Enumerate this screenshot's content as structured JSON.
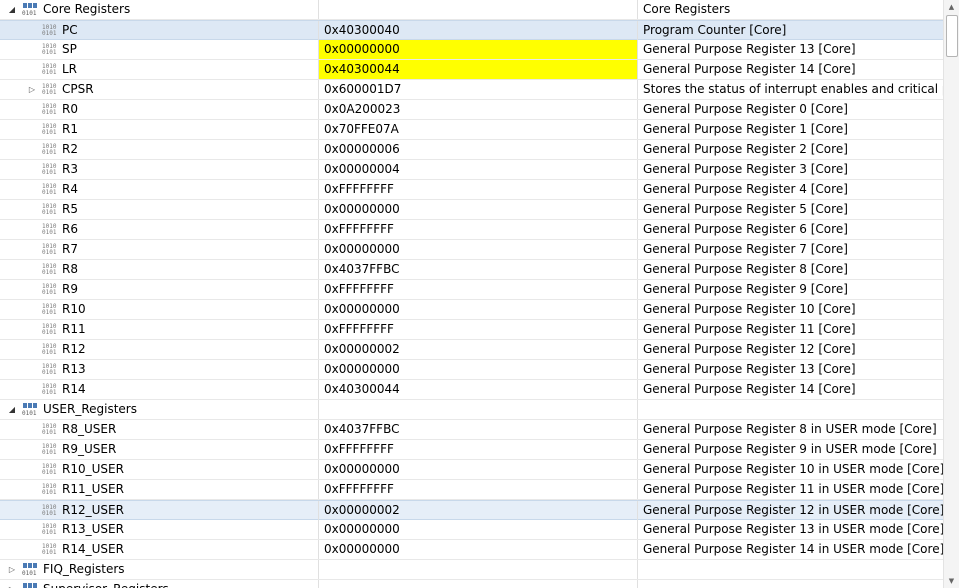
{
  "colors": {
    "selection": "#dde8f5",
    "changed_value": "#ffff00",
    "group_icon": "#5a5a5a"
  },
  "groups": [
    {
      "name": "Core Registers",
      "value": "",
      "description": "Core Registers",
      "expanded": true,
      "registers": [
        {
          "name": "PC",
          "value": "0x40300040",
          "description": "Program Counter [Core]",
          "selected": true
        },
        {
          "name": "SP",
          "value": "0x00000000",
          "description": "General Purpose Register 13 [Core]",
          "changed": true
        },
        {
          "name": "LR",
          "value": "0x40300044",
          "description": "General Purpose Register 14 [Core]",
          "changed": true
        },
        {
          "name": "CPSR",
          "value": "0x600001D7",
          "description": "Stores the status of interrupt enables and critical pr",
          "expandable": true
        },
        {
          "name": "R0",
          "value": "0x0A200023",
          "description": "General Purpose Register 0 [Core]"
        },
        {
          "name": "R1",
          "value": "0x70FFE07A",
          "description": "General Purpose Register 1 [Core]"
        },
        {
          "name": "R2",
          "value": "0x00000006",
          "description": "General Purpose Register 2 [Core]"
        },
        {
          "name": "R3",
          "value": "0x00000004",
          "description": "General Purpose Register 3 [Core]"
        },
        {
          "name": "R4",
          "value": "0xFFFFFFFF",
          "description": "General Purpose Register 4 [Core]"
        },
        {
          "name": "R5",
          "value": "0x00000000",
          "description": "General Purpose Register 5 [Core]"
        },
        {
          "name": "R6",
          "value": "0xFFFFFFFF",
          "description": "General Purpose Register 6 [Core]"
        },
        {
          "name": "R7",
          "value": "0x00000000",
          "description": "General Purpose Register 7 [Core]"
        },
        {
          "name": "R8",
          "value": "0x4037FFBC",
          "description": "General Purpose Register 8 [Core]"
        },
        {
          "name": "R9",
          "value": "0xFFFFFFFF",
          "description": "General Purpose Register 9 [Core]"
        },
        {
          "name": "R10",
          "value": "0x00000000",
          "description": "General Purpose Register 10 [Core]"
        },
        {
          "name": "R11",
          "value": "0xFFFFFFFF",
          "description": "General Purpose Register 11 [Core]"
        },
        {
          "name": "R12",
          "value": "0x00000002",
          "description": "General Purpose Register 12 [Core]"
        },
        {
          "name": "R13",
          "value": "0x00000000",
          "description": "General Purpose Register 13 [Core]"
        },
        {
          "name": "R14",
          "value": "0x40300044",
          "description": "General Purpose Register 14 [Core]"
        }
      ]
    },
    {
      "name": "USER_Registers",
      "value": "",
      "description": "",
      "expanded": true,
      "registers": [
        {
          "name": "R8_USER",
          "value": "0x4037FFBC",
          "description": "General Purpose Register 8 in USER mode [Core]"
        },
        {
          "name": "R9_USER",
          "value": "0xFFFFFFFF",
          "description": "General Purpose Register 9 in USER mode [Core]"
        },
        {
          "name": "R10_USER",
          "value": "0x00000000",
          "description": "General Purpose Register 10 in USER mode [Core]"
        },
        {
          "name": "R11_USER",
          "value": "0xFFFFFFFF",
          "description": "General Purpose Register 11 in USER mode [Core]"
        },
        {
          "name": "R12_USER",
          "value": "0x00000002",
          "description": "General Purpose Register 12 in USER mode [Core]",
          "hover": true
        },
        {
          "name": "R13_USER",
          "value": "0x00000000",
          "description": "General Purpose Register 13 in USER mode [Core]"
        },
        {
          "name": "R14_USER",
          "value": "0x00000000",
          "description": "General Purpose Register 14 in USER mode [Core]"
        }
      ]
    },
    {
      "name": "FIQ_Registers",
      "value": "",
      "description": "",
      "expanded": false,
      "registers": []
    },
    {
      "name": "Supervisor_Registers",
      "value": "",
      "description": "",
      "expanded": false,
      "registers": []
    }
  ]
}
